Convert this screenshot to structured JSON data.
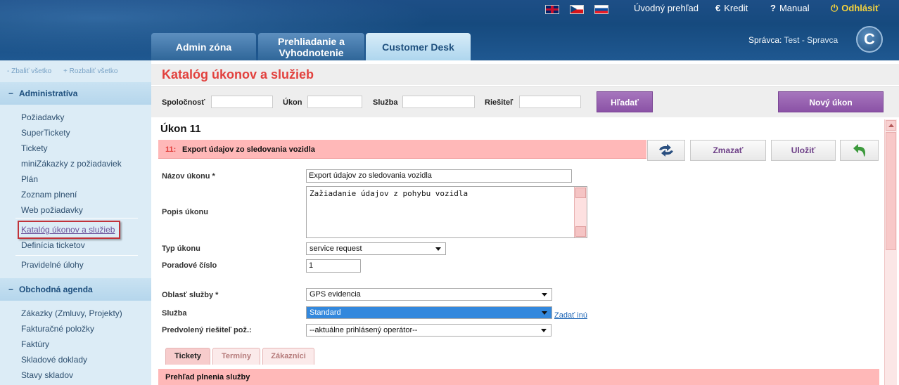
{
  "header": {
    "top_links": {
      "overview": "Úvodný prehľad",
      "credit_icon": "€",
      "credit": "Kredit",
      "manual_icon": "?",
      "manual": "Manual",
      "logout_icon": "⏻",
      "logout": "Odhlásiť"
    },
    "flags": [
      "uk-flag-icon",
      "cz-flag-icon",
      "sk-flag-icon"
    ],
    "tabs": [
      {
        "label": "Admin zóna"
      },
      {
        "label": "Prehliadanie a Vyhodnotenie"
      },
      {
        "label": "Customer Desk"
      }
    ],
    "admin_prefix": "Správca:",
    "admin_name": "Test - Spravca",
    "logo_letter": "C"
  },
  "sidebar": {
    "collapse_all": "- Zbaliť všetko",
    "expand_all": "+ Rozbaliť všetko",
    "sections": [
      {
        "title": "Administratíva",
        "items": [
          "Požiadavky",
          "SuperTickety",
          "Tickety",
          "miniZákazky z požiadaviek",
          "Plán",
          "Zoznam plnení",
          "Web požiadavky",
          "Katalóg úkonov a služieb",
          "Definícia ticketov",
          "Pravidelné úlohy"
        ]
      },
      {
        "title": "Obchodná agenda",
        "items": [
          "Zákazky (Zmluvy, Projekty)",
          "Fakturačné položky",
          "Faktúry",
          "Skladové doklady",
          "Stavy skladov"
        ]
      }
    ]
  },
  "main": {
    "page_title": "Katalóg úkonov a služieb",
    "filters": {
      "company_label": "Spoločnosť",
      "action_label": "Úkon",
      "service_label": "Služba",
      "solver_label": "Riešiteľ",
      "search_button": "Hľadať",
      "new_button": "Nový úkon"
    },
    "record": {
      "title": "Úkon 11",
      "bar_number": "11:",
      "bar_name": "Export údajov zo sledovania vozidla",
      "delete_button": "Zmazať",
      "save_button": "Uložiť"
    },
    "form": {
      "name_label": "Názov úkonu *",
      "name_value": "Export údajov zo sledovania vozidla",
      "description_label": "Popis úkonu",
      "description_value": "Zažiadanie údajov z pohybu vozidla",
      "type_label": "Typ úkonu",
      "type_value": "service request",
      "order_label": "Poradové číslo",
      "order_value": "1",
      "area_label": "Oblasť služby *",
      "area_value": "GPS evidencia",
      "service_label": "Služba",
      "service_value": "Standard",
      "other_link": "Zadať inú",
      "solver_label": "Predvolený riešiteľ pož.:",
      "solver_value": "--aktuálne prihlásený operátor--"
    },
    "subtabs": [
      "Tickety",
      "Termíny",
      "Zákazníci"
    ],
    "overview_title": "Prehľad plnenia služby"
  }
}
